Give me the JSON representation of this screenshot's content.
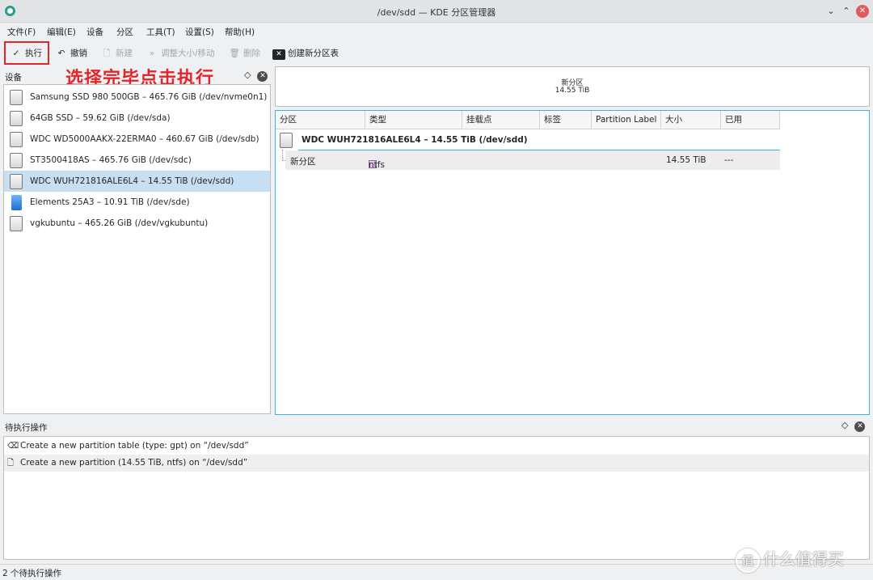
{
  "window": {
    "title": "/dev/sdd — KDE 分区管理器"
  },
  "menubar": [
    {
      "label": "文件(F)"
    },
    {
      "label": "编辑(E)"
    },
    {
      "label": "设备"
    },
    {
      "label": "分区"
    },
    {
      "label": "工具(T)"
    },
    {
      "label": "设置(S)"
    },
    {
      "label": "帮助(H)"
    }
  ],
  "toolbar": {
    "apply": "执行",
    "undo": "撤销",
    "new": "新建",
    "resize": "调整大小/移动",
    "delete": "删除",
    "new_table": "创建新分区表"
  },
  "annotation": "选择完毕点击执行",
  "devices_panel": {
    "header": "设备",
    "items": [
      {
        "label": "Samsung SSD 980 500GB – 465.76 GiB (/dev/nvme0n1)",
        "icon": "drive-icon"
      },
      {
        "label": "64GB SSD – 59.62 GiB (/dev/sda)",
        "icon": "drive-icon"
      },
      {
        "label": "WDC WD5000AAKX-22ERMA0 – 460.67 GiB (/dev/sdb)",
        "icon": "drive-icon"
      },
      {
        "label": "ST3500418AS – 465.76 GiB (/dev/sdc)",
        "icon": "drive-icon"
      },
      {
        "label": "WDC WUH721816ALE6L4 – 14.55 TiB (/dev/sdd)",
        "icon": "drive-icon",
        "selected": true
      },
      {
        "label": "Elements 25A3 – 10.91 TiB (/dev/sde)",
        "icon": "usb-drive-icon"
      },
      {
        "label": "vgkubuntu – 465.26 GiB (/dev/vgkubuntu)",
        "icon": "drive-icon"
      }
    ]
  },
  "partition_graph": {
    "label": "新分区",
    "size": "14.55 TiB"
  },
  "partition_table": {
    "columns": [
      "分区",
      "类型",
      "挂载点",
      "标签",
      "Partition Label",
      "大小",
      "已用"
    ],
    "disk_title": "WDC WUH721816ALE6L4 – 14.55 TiB (/dev/sdd)",
    "rows": [
      {
        "name": "新分区",
        "type": "ntfs",
        "mount": "",
        "label": "",
        "partlabel": "",
        "size": "14.55 TiB",
        "used": "---"
      }
    ]
  },
  "pending_panel": {
    "header": "待执行操作",
    "ops": [
      {
        "label": "Create a new partition table (type: gpt) on “/dev/sdd”"
      },
      {
        "label": "Create a new partition (14.55 TiB, ntfs) on “/dev/sdd”"
      }
    ]
  },
  "statusbar": "2 个待执行操作",
  "watermark": "什么值得买",
  "watermark_badge": "值",
  "colors": {
    "accent": "#3daee9",
    "selected": "#c6dff3",
    "annotation": "#e0262b"
  }
}
